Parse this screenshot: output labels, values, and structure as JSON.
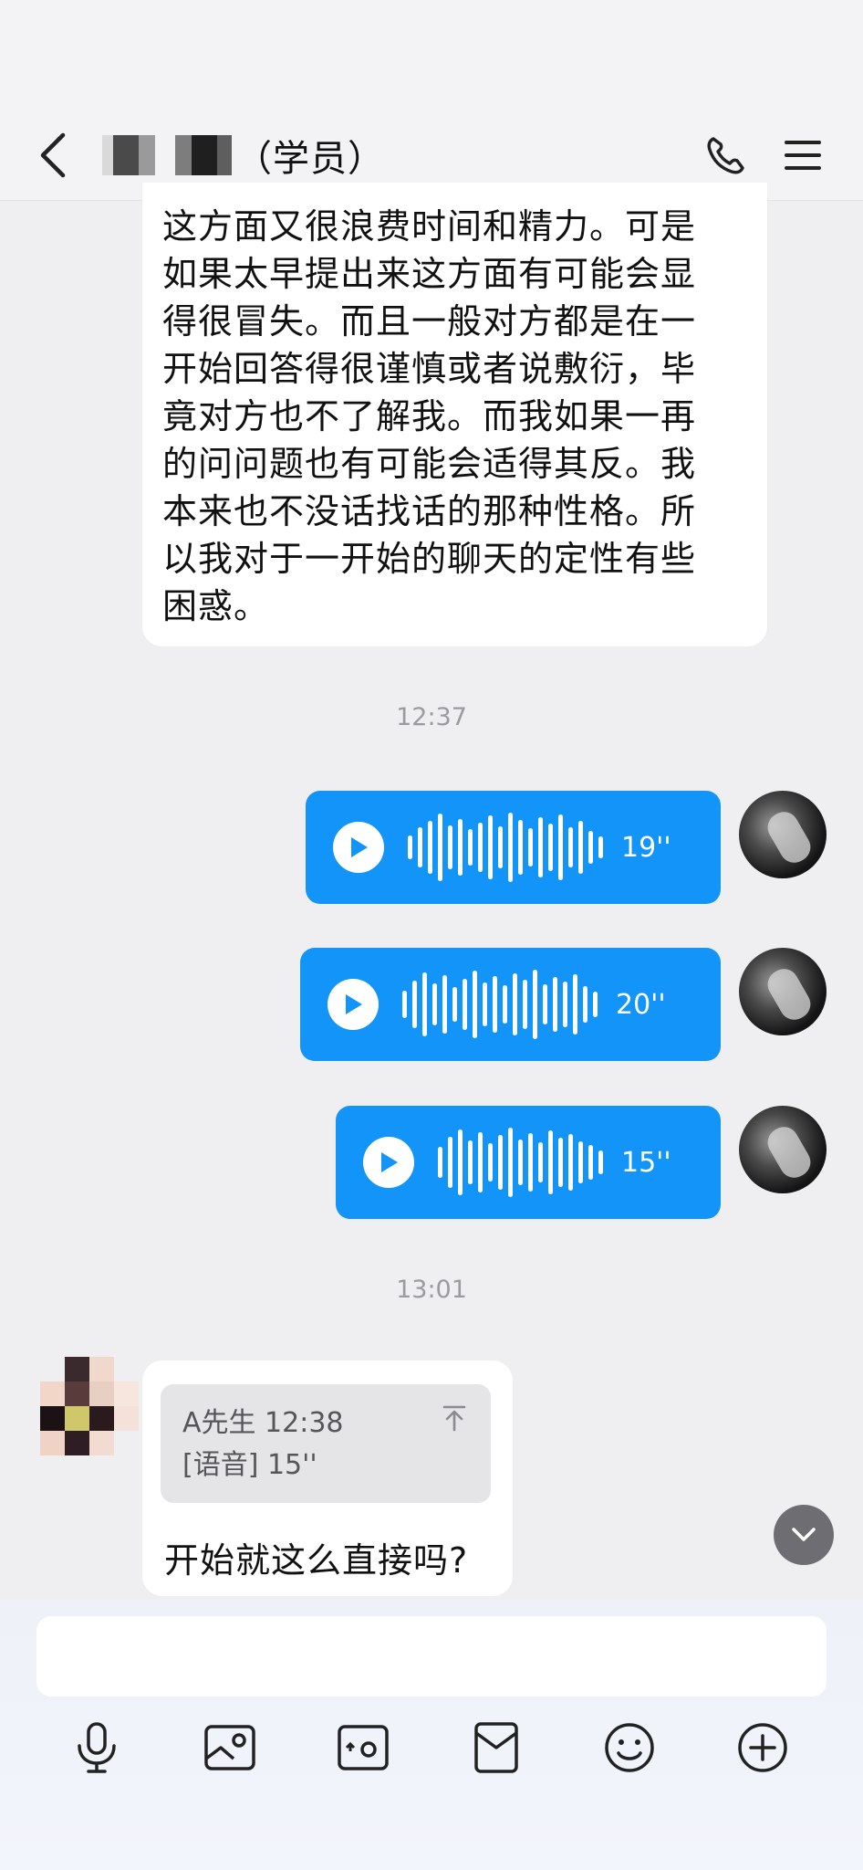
{
  "header": {
    "title": "（学员）",
    "back_icon": "chevron-left-icon",
    "phone_icon": "phone-icon",
    "menu_icon": "menu-icon"
  },
  "messages": {
    "incoming_text": [
      "这方面又很浪费时间和精力。可是",
      "如果太早提出来这方面有可能会显",
      "得很冒失。而且一般对方都是在一",
      "开始回答得很谨慎或者说敷衍，毕",
      "竟对方也不了解我。而我如果一再",
      "的问问题也有可能会适得其反。我",
      "本来也不没话找话的那种性格。所",
      "以我对于一开始的聊天的定性有些",
      "困惑。"
    ],
    "timestamp_1": "12:37",
    "voice_messages": [
      {
        "duration": "19''"
      },
      {
        "duration": "20''"
      },
      {
        "duration": "15''"
      }
    ],
    "timestamp_2": "13:01",
    "quoted": {
      "sender_time": "A先生 12:38",
      "content": "[语音] 15''"
    },
    "reply_text": "开始就这么直接吗?"
  },
  "colors": {
    "accent": "#1394f8",
    "background": "#efeff1"
  },
  "toolbar": {
    "icons": [
      "microphone-icon",
      "image-icon",
      "camera-icon",
      "red-packet-icon",
      "emoji-icon",
      "plus-icon"
    ]
  }
}
